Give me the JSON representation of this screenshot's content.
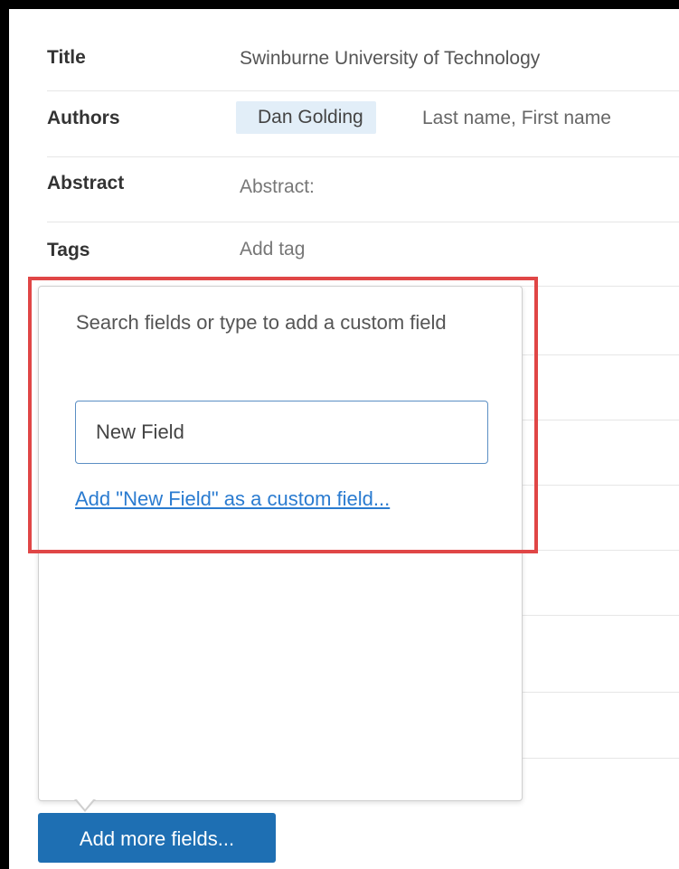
{
  "fields": {
    "title": {
      "label": "Title",
      "value": "Swinburne University of Technology"
    },
    "authors": {
      "label": "Authors",
      "chip": "Dan Golding",
      "placeholder": "Last name, First name"
    },
    "abstract": {
      "label": "Abstract",
      "placeholder": "Abstract:"
    },
    "tags": {
      "label": "Tags",
      "placeholder": "Add tag"
    }
  },
  "popover": {
    "hint": "Search fields or type to add a custom field",
    "input_value": "New Field",
    "add_link": "Add \"New Field\" as a custom field..."
  },
  "footer": {
    "add_more_label": "Add more fields..."
  },
  "colors": {
    "highlight": "#e04646",
    "button": "#1e6fb3",
    "link": "#2a7bd0",
    "chip": "#e2eef8"
  }
}
